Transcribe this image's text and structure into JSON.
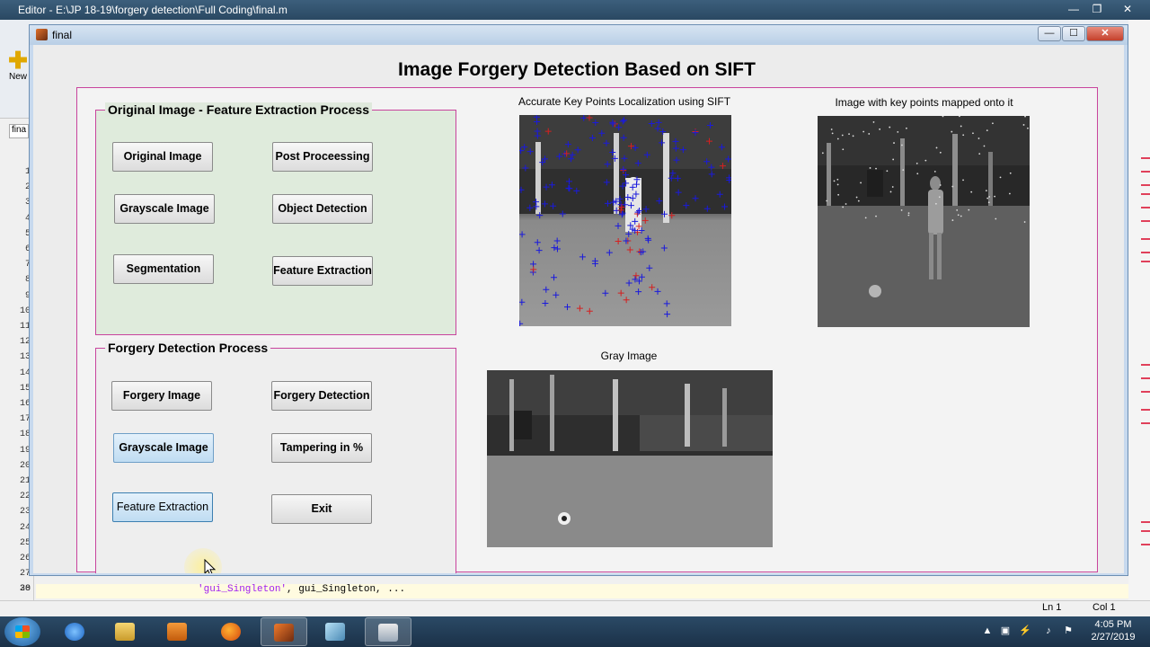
{
  "editor": {
    "title": "Editor - E:\\JP 18-19\\forgery detection\\Full Coding\\final.m",
    "new_label": "New",
    "tab_label": "fina",
    "code_string": "'gui_Singleton'",
    "code_rest": ",  gui_Singleton, ...",
    "line_last": "30",
    "line_numbers": [
      "1",
      "2",
      "3",
      "4",
      "5",
      "6",
      "7",
      "8",
      "9",
      "10",
      "11",
      "12",
      "13",
      "14",
      "15",
      "16",
      "17",
      "18",
      "19",
      "20",
      "21",
      "22",
      "23",
      "24",
      "25",
      "26",
      "27",
      "28",
      "29"
    ],
    "status_ln": "Ln  1",
    "status_col": "Col  1"
  },
  "figure": {
    "title": "final",
    "app_title": "Image Forgery Detection Based on SIFT"
  },
  "panel1": {
    "title": "Original Image - Feature Extraction Process",
    "buttons": [
      "Original Image",
      "Post Proceessing",
      "Grayscale Image",
      "Object Detection",
      "Segmentation",
      "Feature Extraction"
    ]
  },
  "panel2": {
    "title": "Forgery Detection Process",
    "buttons": [
      "Forgery Image",
      "Forgery Detection",
      "Grayscale Image",
      "Tampering in %",
      "Feature Extraction",
      "Exit"
    ]
  },
  "images": {
    "keypoints_caption": "Accurate Key Points Localization using SIFT",
    "mapped_caption": "Image with key points mapped onto it",
    "gray_caption": "Gray Image"
  },
  "taskbar": {
    "time": "4:05 PM",
    "date": "2/27/2019"
  },
  "colors": {
    "panel_border": "#c8449d",
    "panel_green": "#dfebdc",
    "keypoint_blue": "#1a1adc",
    "keypoint_red": "#d42020"
  }
}
